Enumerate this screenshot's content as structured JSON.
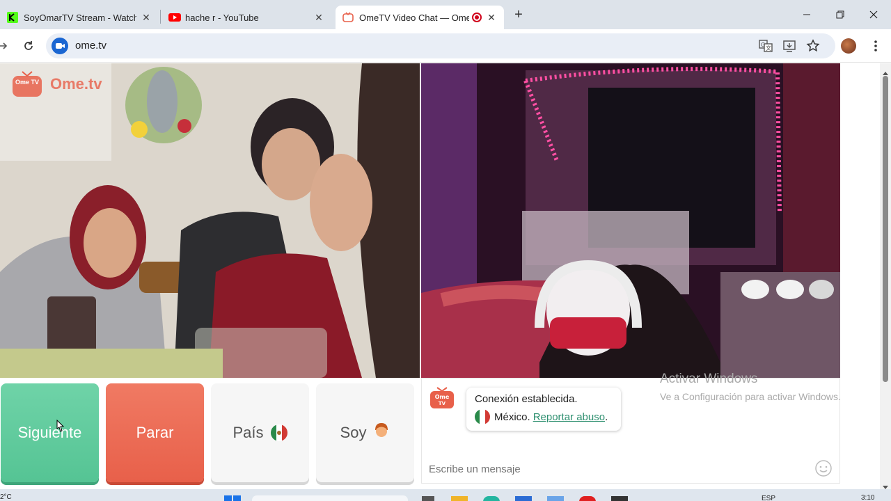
{
  "browser": {
    "tabs": [
      {
        "title": "SoyOmarTV Stream - Watch Liv",
        "favicon": "kick-icon",
        "color": "#53fc18"
      },
      {
        "title": "hache r - YouTube",
        "favicon": "youtube-icon",
        "color": "#ff0000"
      },
      {
        "title": "OmeTV Video Chat — Ome",
        "favicon": "ometv-icon",
        "color": "#e8604a",
        "recording": true
      }
    ],
    "new_tab": "+",
    "url": "ome.tv"
  },
  "app": {
    "logo_badge": "Ome TV",
    "logo_text": "Ome.tv",
    "buttons": {
      "next": "Siguiente",
      "stop": "Parar",
      "country": "País",
      "gender": "Soy"
    },
    "chat": {
      "status": "Conexión establecida.",
      "country": "México.",
      "report": "Reportar abuso",
      "report_suffix": ".",
      "placeholder": "Escribe un mensaje"
    },
    "colors": {
      "brand_green": "#55c494",
      "brand_red": "#e8604a"
    }
  },
  "watermark": {
    "title": "Activar Windows",
    "subtitle": "Ve a Configuración para activar Windows."
  },
  "taskbar": {
    "weather": "2°C",
    "lang": "ESP",
    "time": "3:10"
  }
}
